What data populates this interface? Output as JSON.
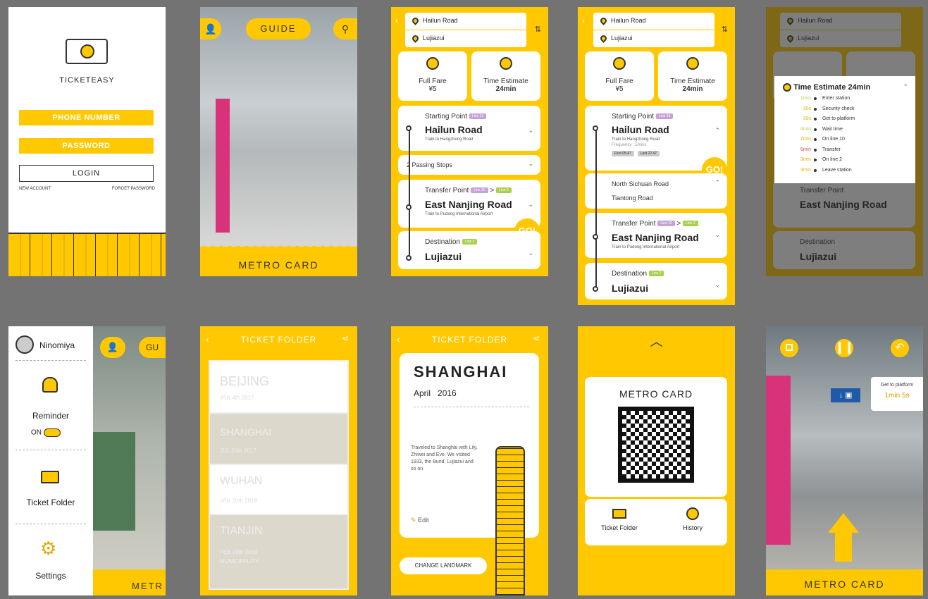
{
  "login": {
    "app_name": "TICKETEASY",
    "phone": "PHONE NUMBER",
    "password": "PASSWORD",
    "login": "LOGIN",
    "new_account": "NEW ACCOUNT",
    "forget": "FORGET PASSWORD"
  },
  "guide": {
    "title": "GUIDE",
    "footer": "METRO CARD"
  },
  "route": {
    "from": "Hailun Road",
    "to": "Lujiazui",
    "fare_label": "Full Fare",
    "fare": "¥5",
    "time_label": "Time Estimate",
    "time": "24min",
    "start_label": "Starting Point",
    "start_tag": "Line 10",
    "start_name": "Hailun Road",
    "start_sub": "Train to Hangzhong Road",
    "freq": "Frequency : 5mins",
    "first": "First",
    "first_t": "05:47",
    "last": "Last",
    "last_t": "22:47",
    "passing": "2 Passing Stops",
    "stop1": "North Sichuan Road",
    "stop2": "Tiantong Road",
    "transfer_label": "Transfer Point",
    "transfer_tag1": "Line 10",
    "transfer_tag2": "Line 2",
    "transfer_name": "East Nanjing Road",
    "transfer_sub": "Train to Pudong International Airport",
    "dest_label": "Destination",
    "dest_tag": "Line 2",
    "dest_name": "Lujiazui",
    "go": "GO!"
  },
  "timeline": {
    "title": "Time Estimate",
    "total": "24min",
    "steps": [
      {
        "t": "1min",
        "s": "Enter station",
        "c": "#b8d44c"
      },
      {
        "t": "30s",
        "s": "Security check",
        "c": "#e0b400"
      },
      {
        "t": "30s",
        "s": "Get to platform",
        "c": "#e0b400"
      },
      {
        "t": "4min",
        "s": "Wait time",
        "c": "#b8d44c"
      },
      {
        "t": "7min",
        "s": "On line 10",
        "c": "#e0b400"
      },
      {
        "t": "6min",
        "s": "Transfer",
        "c": "#e05050"
      },
      {
        "t": "3min",
        "s": "On line 2",
        "c": "#e0b400"
      },
      {
        "t": "3min",
        "s": "Leave station",
        "c": "#e0b400"
      }
    ]
  },
  "menu": {
    "user": "Ninomiya",
    "reminder": "Reminder",
    "on": "ON",
    "folder": "Ticket Folder",
    "settings": "Settings",
    "footer": "METR",
    "gu": "GU"
  },
  "folder": {
    "title": "TICKET FOLDER",
    "tickets": [
      {
        "city": "BEIJING",
        "date": "JAN 4th 2017"
      },
      {
        "city": "SHANGHAI",
        "date": "JUL 20th 2017"
      },
      {
        "city": "WUHAN",
        "date": "JAN 20th 2018"
      },
      {
        "city": "TIANJIN",
        "date": "FEB 20th 2016",
        "extra": "MUNICIPALITY"
      }
    ]
  },
  "detail": {
    "title": "TICKET FOLDER",
    "city": "SHANGHAI",
    "month": "April",
    "year": "2016",
    "note": "Traveled to Shanghai with Lily, Zhiwei and Eve. We visited 1933, the Bund, Lujiazui and so on.",
    "edit": "Edit",
    "change": "CHANGE LANDMARK"
  },
  "card": {
    "title": "METRO CARD",
    "folder": "Ticket Folder",
    "history": "History"
  },
  "ar": {
    "hint": "Get to platform",
    "time": "1min 5s",
    "footer": "METRO CARD"
  },
  "colors": {
    "accent": "#FFC800",
    "bg": "#737373"
  }
}
